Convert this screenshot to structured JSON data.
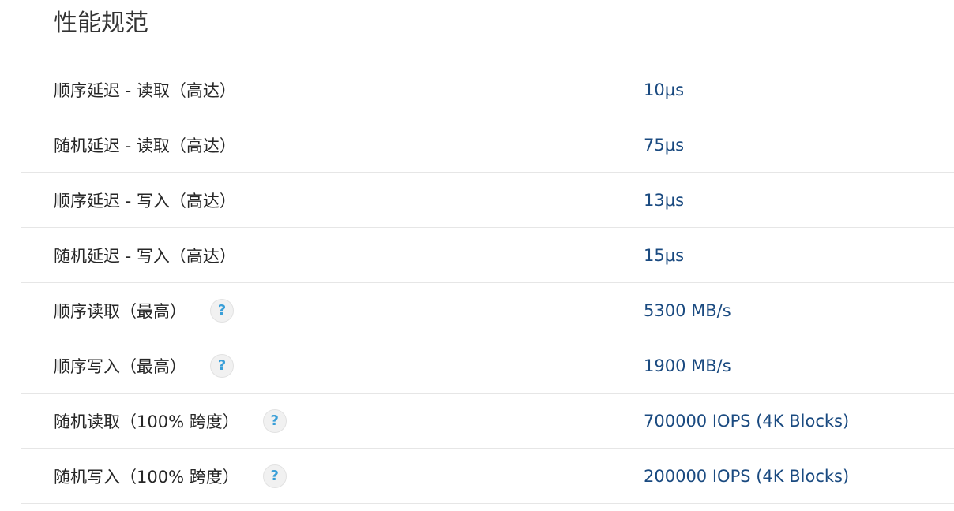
{
  "section": {
    "title": "性能规范"
  },
  "help_icon": {
    "glyph": "?",
    "color": "#3a9fd8",
    "icon_name": "question-mark-icon"
  },
  "colors": {
    "label": "#262626",
    "value": "#1a4a80",
    "divider": "#e6e6e6"
  },
  "specs": [
    {
      "label": "顺序延迟 - 读取（高达）",
      "value": "10μs"
    },
    {
      "label": "随机延迟 - 读取（高达）",
      "value": "75μs"
    },
    {
      "label": "顺序延迟 - 写入（高达）",
      "value": "13μs"
    },
    {
      "label": "随机延迟 - 写入（高达）",
      "value": "15μs"
    },
    {
      "label": "顺序读取（最高）",
      "value": "5300 MB/s"
    },
    {
      "label": "顺序写入（最高）",
      "value": "1900 MB/s"
    },
    {
      "label": "随机读取（100% 跨度）",
      "value": "700000 IOPS (4K Blocks)"
    },
    {
      "label": "随机写入（100% 跨度）",
      "value": "200000 IOPS (4K Blocks)"
    }
  ]
}
